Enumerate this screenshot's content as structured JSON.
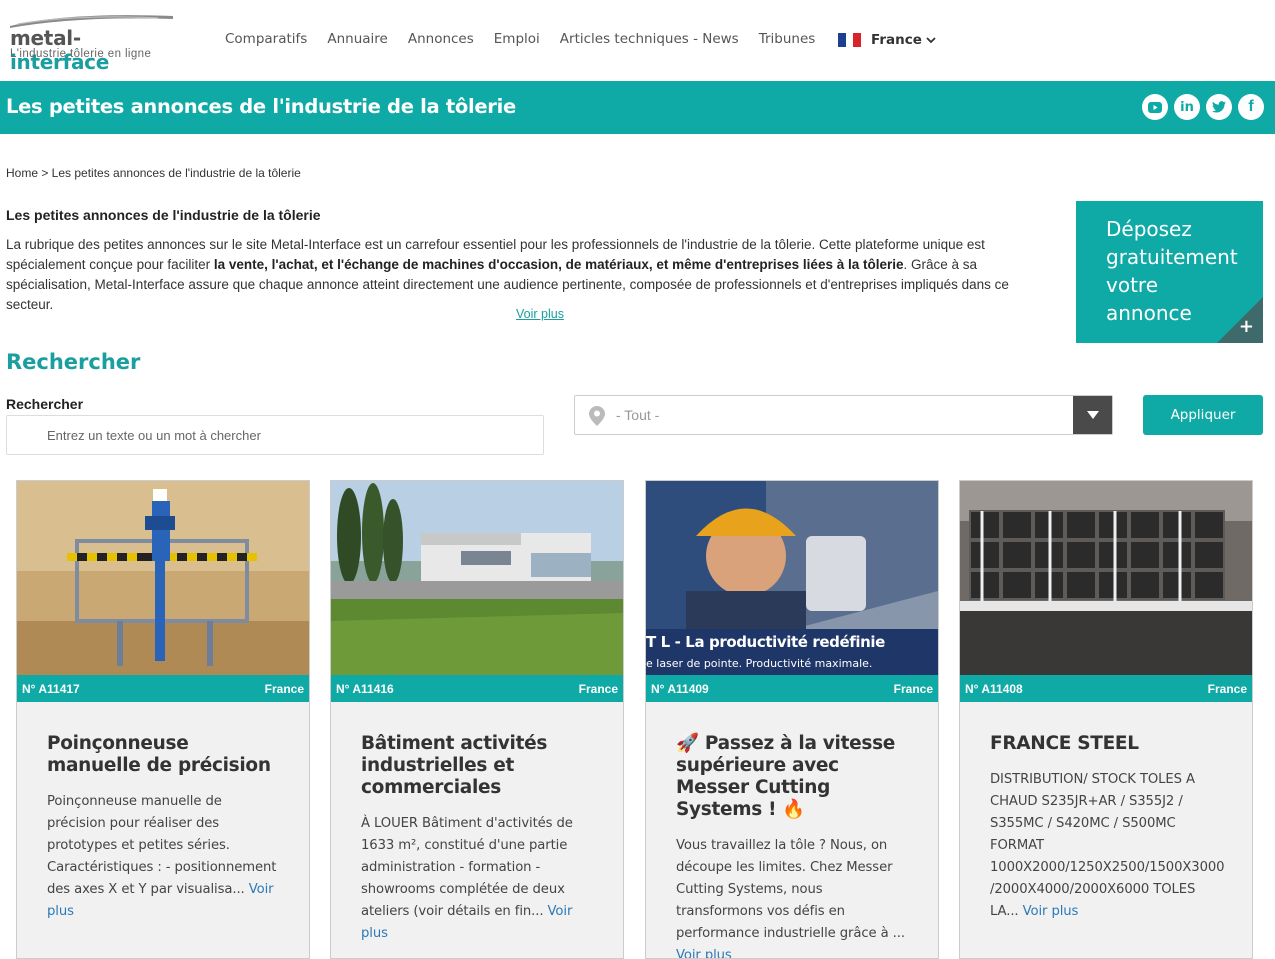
{
  "header": {
    "logo_name_part1": "metal-",
    "logo_name_part2": "interface",
    "logo_tagline": "L'industrie tôlerie en ligne",
    "nav": [
      "Comparatifs",
      "Annuaire",
      "Annonces",
      "Emploi",
      "Articles techniques - News",
      "Tribunes"
    ],
    "country": "France"
  },
  "banner": {
    "title": "Les petites annonces de l'industrie de la tôlerie",
    "socials": [
      "youtube-icon",
      "linkedin-icon",
      "twitter-icon",
      "facebook-icon"
    ]
  },
  "breadcrumb": "Home > Les petites annonces de l'industrie de la tôlerie",
  "intro": {
    "title": "Les petites annonces de l'industrie de la tôlerie",
    "text_1": "La rubrique des petites annonces sur le site Metal-Interface est un carrefour essentiel pour les professionnels de l'industrie de la tôlerie. Cette plateforme unique est spécialement conçue pour faciliter ",
    "text_bold": "la vente, l'achat, et l'échange de machines d'occasion, de matériaux, et même d'entreprises liées à la tôlerie",
    "text_2": ". Grâce à sa spécialisation, Metal-Interface assure que chaque annonce atteint directement une audience pertinente, composée de professionnels et d'entreprises impliqués dans ce secteur.",
    "voir_plus": "Voir plus"
  },
  "depose": {
    "label": "Déposez gratuitement votre annonce",
    "plus": "+"
  },
  "search": {
    "section_title": "Rechercher",
    "label": "Rechercher",
    "placeholder": "Entrez un texte ou un mot à chercher",
    "location_value": "- Tout -",
    "apply_label": "Appliquer"
  },
  "cards": [
    {
      "ref": "N° A11417",
      "country": "France",
      "title": "Poinçonneuse manuelle de précision",
      "desc": "Poinçonneuse manuelle de précision pour réaliser des prototypes et petites séries. Caractéristiques : - positionnement des axes X et Y par visualisa...",
      "more": "Voir plus"
    },
    {
      "ref": "N° A11416",
      "country": "France",
      "title": "Bâtiment activités industrielles et commerciales",
      "desc": "À LOUER Bâtiment d'activités de 1633 m², constitué d'une partie administration - formation - showrooms complétée de deux ateliers (voir détails en fin...",
      "more": "Voir plus"
    },
    {
      "ref": "N° A11409",
      "country": "France",
      "title": "🚀 Passez à la vitesse supérieure avec Messer Cutting Systems ! 🔥",
      "desc": "Vous travaillez la tôle ? Nous, on découpe les limites. Chez Messer Cutting Systems, nous transformons vos défis en performance industrielle grâce à ...",
      "more": "Voir plus",
      "img_text_1": "T L - La productivité redéfinie",
      "img_text_2": "e laser de pointe. Productivité maximale."
    },
    {
      "ref": "N° A11408",
      "country": "France",
      "title": "FRANCE STEEL",
      "desc": "DISTRIBUTION/ STOCK TOLES A CHAUD S235JR+AR / S355J2 / S355MC / S420MC / S500MC FORMAT 1000X2000/1250X2500/1500X3000 /2000X4000/2000X6000 TOLES LA...",
      "more": "Voir plus"
    }
  ]
}
